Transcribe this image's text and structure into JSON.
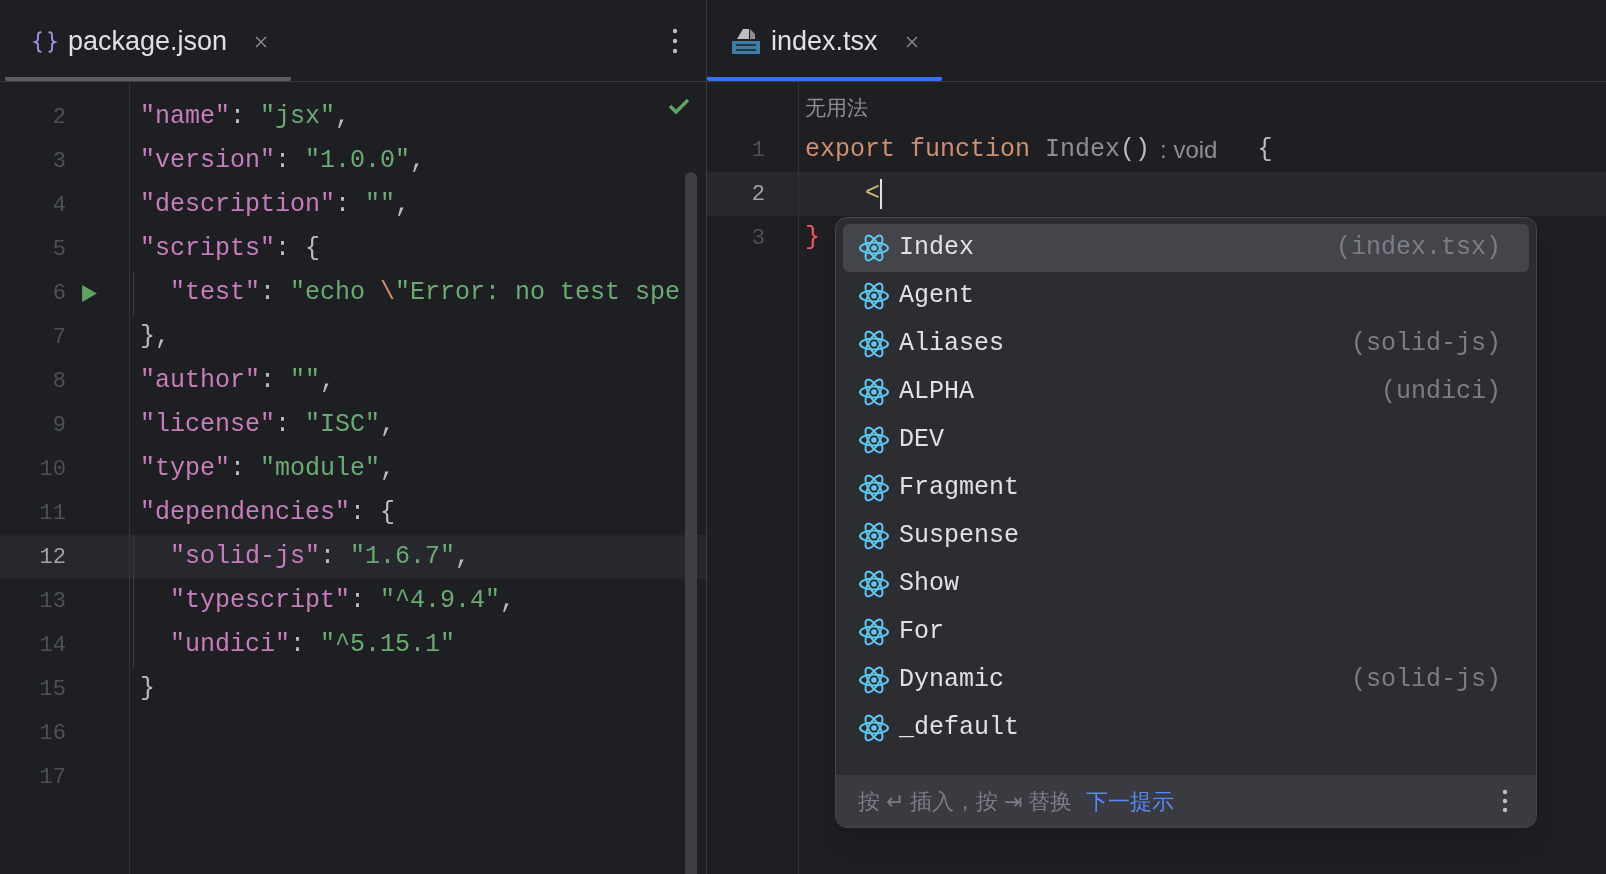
{
  "panes": [
    {
      "focused": false,
      "tab": {
        "label": "package.json",
        "selected": true
      },
      "check": true,
      "lines": [
        {
          "number": "2",
          "tokens": [
            {
              "kind": "key",
              "text": "\"name\""
            },
            {
              "kind": "punct",
              "text": ": "
            },
            {
              "kind": "string",
              "text": "\"jsx\""
            },
            {
              "kind": "punct",
              "text": ","
            }
          ]
        },
        {
          "number": "3",
          "tokens": [
            {
              "kind": "key",
              "text": "\"version\""
            },
            {
              "kind": "punct",
              "text": ": "
            },
            {
              "kind": "string",
              "text": "\"1.0.0\""
            },
            {
              "kind": "punct",
              "text": ","
            }
          ]
        },
        {
          "number": "4",
          "tokens": [
            {
              "kind": "key",
              "text": "\"description\""
            },
            {
              "kind": "punct",
              "text": ": "
            },
            {
              "kind": "string",
              "text": "\"\""
            },
            {
              "kind": "punct",
              "text": ","
            }
          ]
        },
        {
          "number": "5",
          "tokens": [
            {
              "kind": "key",
              "text": "\"scripts\""
            },
            {
              "kind": "punct",
              "text": ": {"
            }
          ]
        },
        {
          "number": "6",
          "run": true,
          "tokens": [
            {
              "kind": "key",
              "text": "  \"test\""
            },
            {
              "kind": "punct",
              "text": ": "
            },
            {
              "kind": "string",
              "text": "\"echo "
            },
            {
              "kind": "escape",
              "text": "\\"
            },
            {
              "kind": "string",
              "text": "\"Error: no test spe"
            }
          ]
        },
        {
          "number": "7",
          "tokens": [
            {
              "kind": "punct",
              "text": "},"
            }
          ]
        },
        {
          "number": "8",
          "tokens": [
            {
              "kind": "key",
              "text": "\"author\""
            },
            {
              "kind": "punct",
              "text": ": "
            },
            {
              "kind": "string",
              "text": "\"\""
            },
            {
              "kind": "punct",
              "text": ","
            }
          ]
        },
        {
          "number": "9",
          "tokens": [
            {
              "kind": "key",
              "text": "\"license\""
            },
            {
              "kind": "punct",
              "text": ": "
            },
            {
              "kind": "string",
              "text": "\"ISC\""
            },
            {
              "kind": "punct",
              "text": ","
            }
          ]
        },
        {
          "number": "10",
          "tokens": [
            {
              "kind": "key",
              "text": "\"type\""
            },
            {
              "kind": "punct",
              "text": ": "
            },
            {
              "kind": "string",
              "text": "\"module\""
            },
            {
              "kind": "punct",
              "text": ","
            }
          ]
        },
        {
          "number": "11",
          "tokens": [
            {
              "kind": "key",
              "text": "\"dependencies\""
            },
            {
              "kind": "punct",
              "text": ": {"
            }
          ]
        },
        {
          "number": "12",
          "current": true,
          "tokens": [
            {
              "kind": "key",
              "text": "  \"solid-js\""
            },
            {
              "kind": "punct",
              "text": ": "
            },
            {
              "kind": "string",
              "text": "\"1.6.7\""
            },
            {
              "kind": "punct",
              "text": ","
            }
          ]
        },
        {
          "number": "13",
          "tokens": [
            {
              "kind": "key",
              "text": "  \"typescript\""
            },
            {
              "kind": "punct",
              "text": ": "
            },
            {
              "kind": "string",
              "text": "\"^4.9.4\""
            },
            {
              "kind": "punct",
              "text": ","
            }
          ]
        },
        {
          "number": "14",
          "tokens": [
            {
              "kind": "key",
              "text": "  \"undici\""
            },
            {
              "kind": "punct",
              "text": ": "
            },
            {
              "kind": "string",
              "text": "\"^5.15.1\""
            }
          ]
        },
        {
          "number": "15",
          "tokens": [
            {
              "kind": "punct",
              "text": "}"
            }
          ]
        },
        {
          "number": "16"
        },
        {
          "number": "17"
        }
      ]
    },
    {
      "focused": true,
      "tab": {
        "label": "index.tsx",
        "selected": true
      },
      "usage_hint": "无用法",
      "lines": [
        {
          "number": "1",
          "tokens": [
            {
              "kind": "keyword",
              "text": "export function"
            },
            {
              "kind": "unused",
              "text": " Index"
            },
            {
              "kind": "punct",
              "text": "()"
            },
            {
              "kind": "hint",
              "text": ": void"
            },
            {
              "kind": "punct",
              "text": "  {"
            }
          ]
        },
        {
          "number": "2",
          "current": true,
          "caret": true,
          "tokens": [
            {
              "kind": "tag",
              "text": "    <"
            }
          ]
        },
        {
          "number": "3",
          "tokens": [
            {
              "kind": "error",
              "text": "}"
            }
          ]
        }
      ]
    }
  ],
  "completion": {
    "items": [
      {
        "name": "Index",
        "source": "(index.tsx)",
        "selected": true
      },
      {
        "name": "Agent",
        "selected": false
      },
      {
        "name": "Aliases",
        "source": "(solid-js)",
        "selected": false
      },
      {
        "name": "ALPHA",
        "source": "(undici)",
        "selected": false
      },
      {
        "name": "DEV",
        "selected": false
      },
      {
        "name": "Fragment",
        "selected": false
      },
      {
        "name": "Suspense",
        "selected": false
      },
      {
        "name": "Show",
        "selected": false
      },
      {
        "name": "For",
        "selected": false
      },
      {
        "name": "Dynamic",
        "source": "(solid-js)",
        "selected": false
      },
      {
        "name": "_default",
        "selected": false
      }
    ],
    "footer": {
      "hint": "按 ↵ 插入，按 ⇥ 替换",
      "link": "下一提示"
    }
  }
}
